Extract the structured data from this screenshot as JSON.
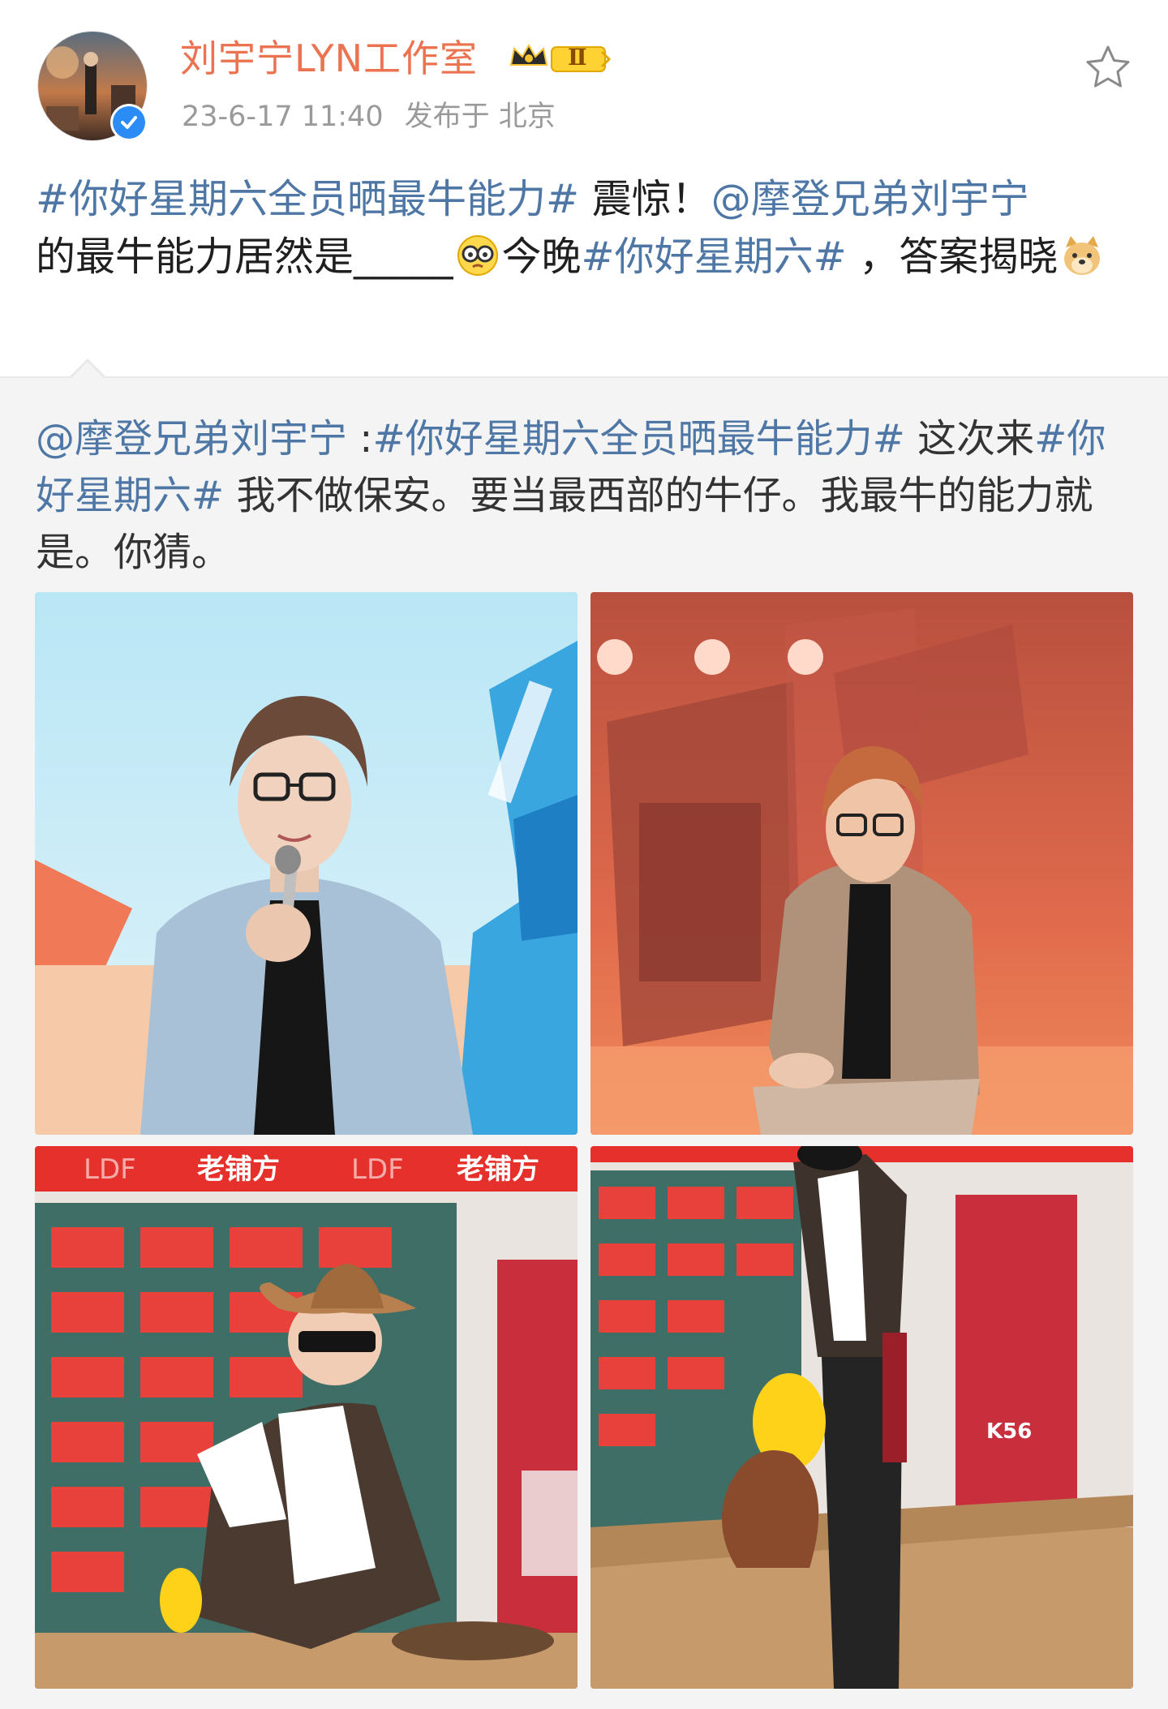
{
  "post": {
    "author": "刘宇宁LYN工作室",
    "member_level": "Ⅱ",
    "date": "23-6-17 11:40",
    "location": "发布于 北京",
    "text": {
      "tag1": "#你好星期六全员晒最牛能力#",
      "s1": " 震惊！",
      "mention": "@摩登兄弟刘宇宁",
      "s2": "的最牛能力居然是_____",
      "s3": "今晚",
      "tag2": "#你好星期六#",
      "s4": " ，答案揭晓"
    }
  },
  "repost": {
    "mention": "@摩登兄弟刘宇宁",
    "colon": " :",
    "tag1": "#你好星期六全员晒最牛能力#",
    "s1": " 这次来",
    "tag2": "#你好星期六#",
    "s2": " 我不做保安。要当最西部的牛仔。我最牛的能力就是。你猜。"
  },
  "icons": {
    "favorite": "star-outline-icon",
    "verified": "verified-check-icon",
    "emoji1": "glasses-face-emoji",
    "emoji2": "doge-emoji"
  },
  "photos": {
    "sign_brand": "LDF",
    "sign_text": "老铺方",
    "sign_k56": "K56"
  },
  "colors": {
    "username": "#eb7350",
    "link": "#4e77a6",
    "verified": "#2c8cf5",
    "repost_bg": "#f4f4f4"
  }
}
